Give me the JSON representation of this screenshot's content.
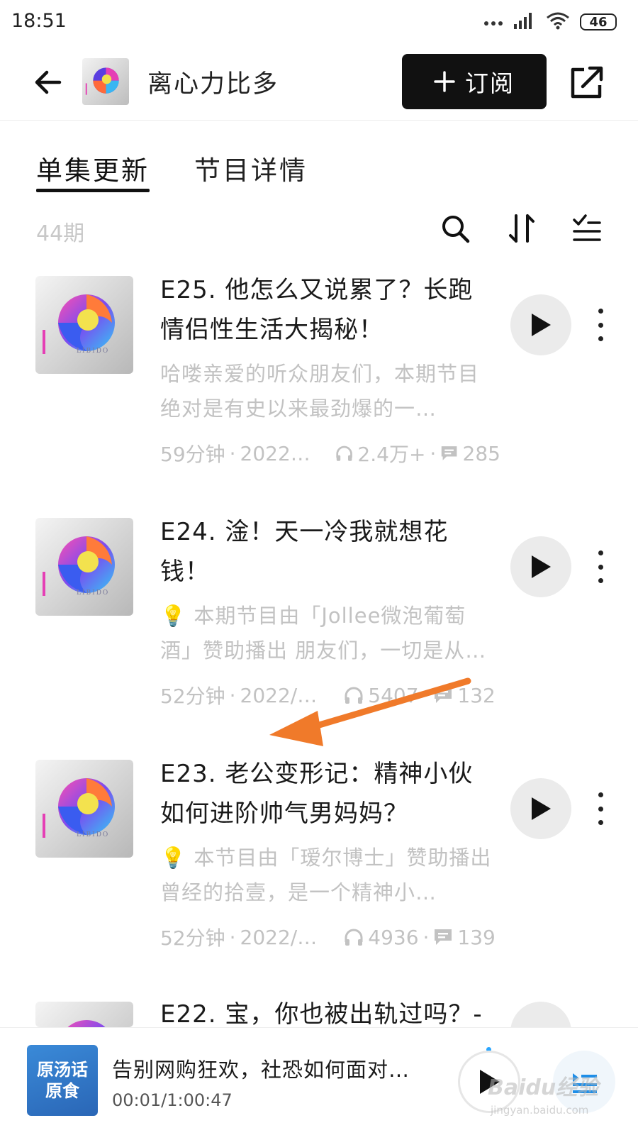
{
  "status_bar": {
    "time": "18:51",
    "battery": "46"
  },
  "header": {
    "title": "离心力比多",
    "subscribe_label": "订阅"
  },
  "tabs": [
    {
      "label": "单集更新",
      "active": true
    },
    {
      "label": "节目详情",
      "active": false
    }
  ],
  "toolbar": {
    "episode_count": "44期",
    "icons": [
      "search-icon",
      "sort-icon",
      "filter-list-icon"
    ]
  },
  "episodes": [
    {
      "title": "E25. 他怎么又说累了？长跑情侣性生活大揭秘！",
      "description": "哈喽亲爱的听众朋友们，本期节目绝对是有史以来最劲爆的一…",
      "duration": "59分钟",
      "date": "2022…",
      "plays": "2.4万+",
      "comments": "285"
    },
    {
      "title": "E24. 淦！天一冷我就想花钱！",
      "description": "💡 本期节目由「Jollee微泡葡萄酒」赞助播出 朋友们，一切是从…",
      "duration": "52分钟",
      "date": "2022/…",
      "plays": "5407",
      "comments": "132"
    },
    {
      "title": "E23. 老公变形记：精神小伙如何进阶帅气男妈妈？",
      "description": "💡 本节目由「瑷尔博士」赞助播出 曾经的拾壹，是一个精神小…",
      "duration": "52分钟",
      "date": "2022/…",
      "plays": "4936",
      "comments": "139"
    },
    {
      "title": "E22. 宝，你也被出轨过吗？-",
      "description": "",
      "duration": "",
      "date": "",
      "plays": "",
      "comments": ""
    }
  ],
  "player": {
    "title": "告别网购狂欢，社恐如何面对…",
    "time": "00:01/1:00:47",
    "cover_text": "原汤话原食"
  },
  "watermark": {
    "text": "Baidu经验",
    "sub": "jingyan.baidu.com"
  },
  "colors": {
    "accent": "#111111",
    "muted": "#c2c2c2",
    "annotation_arrow": "#f07a2a"
  }
}
